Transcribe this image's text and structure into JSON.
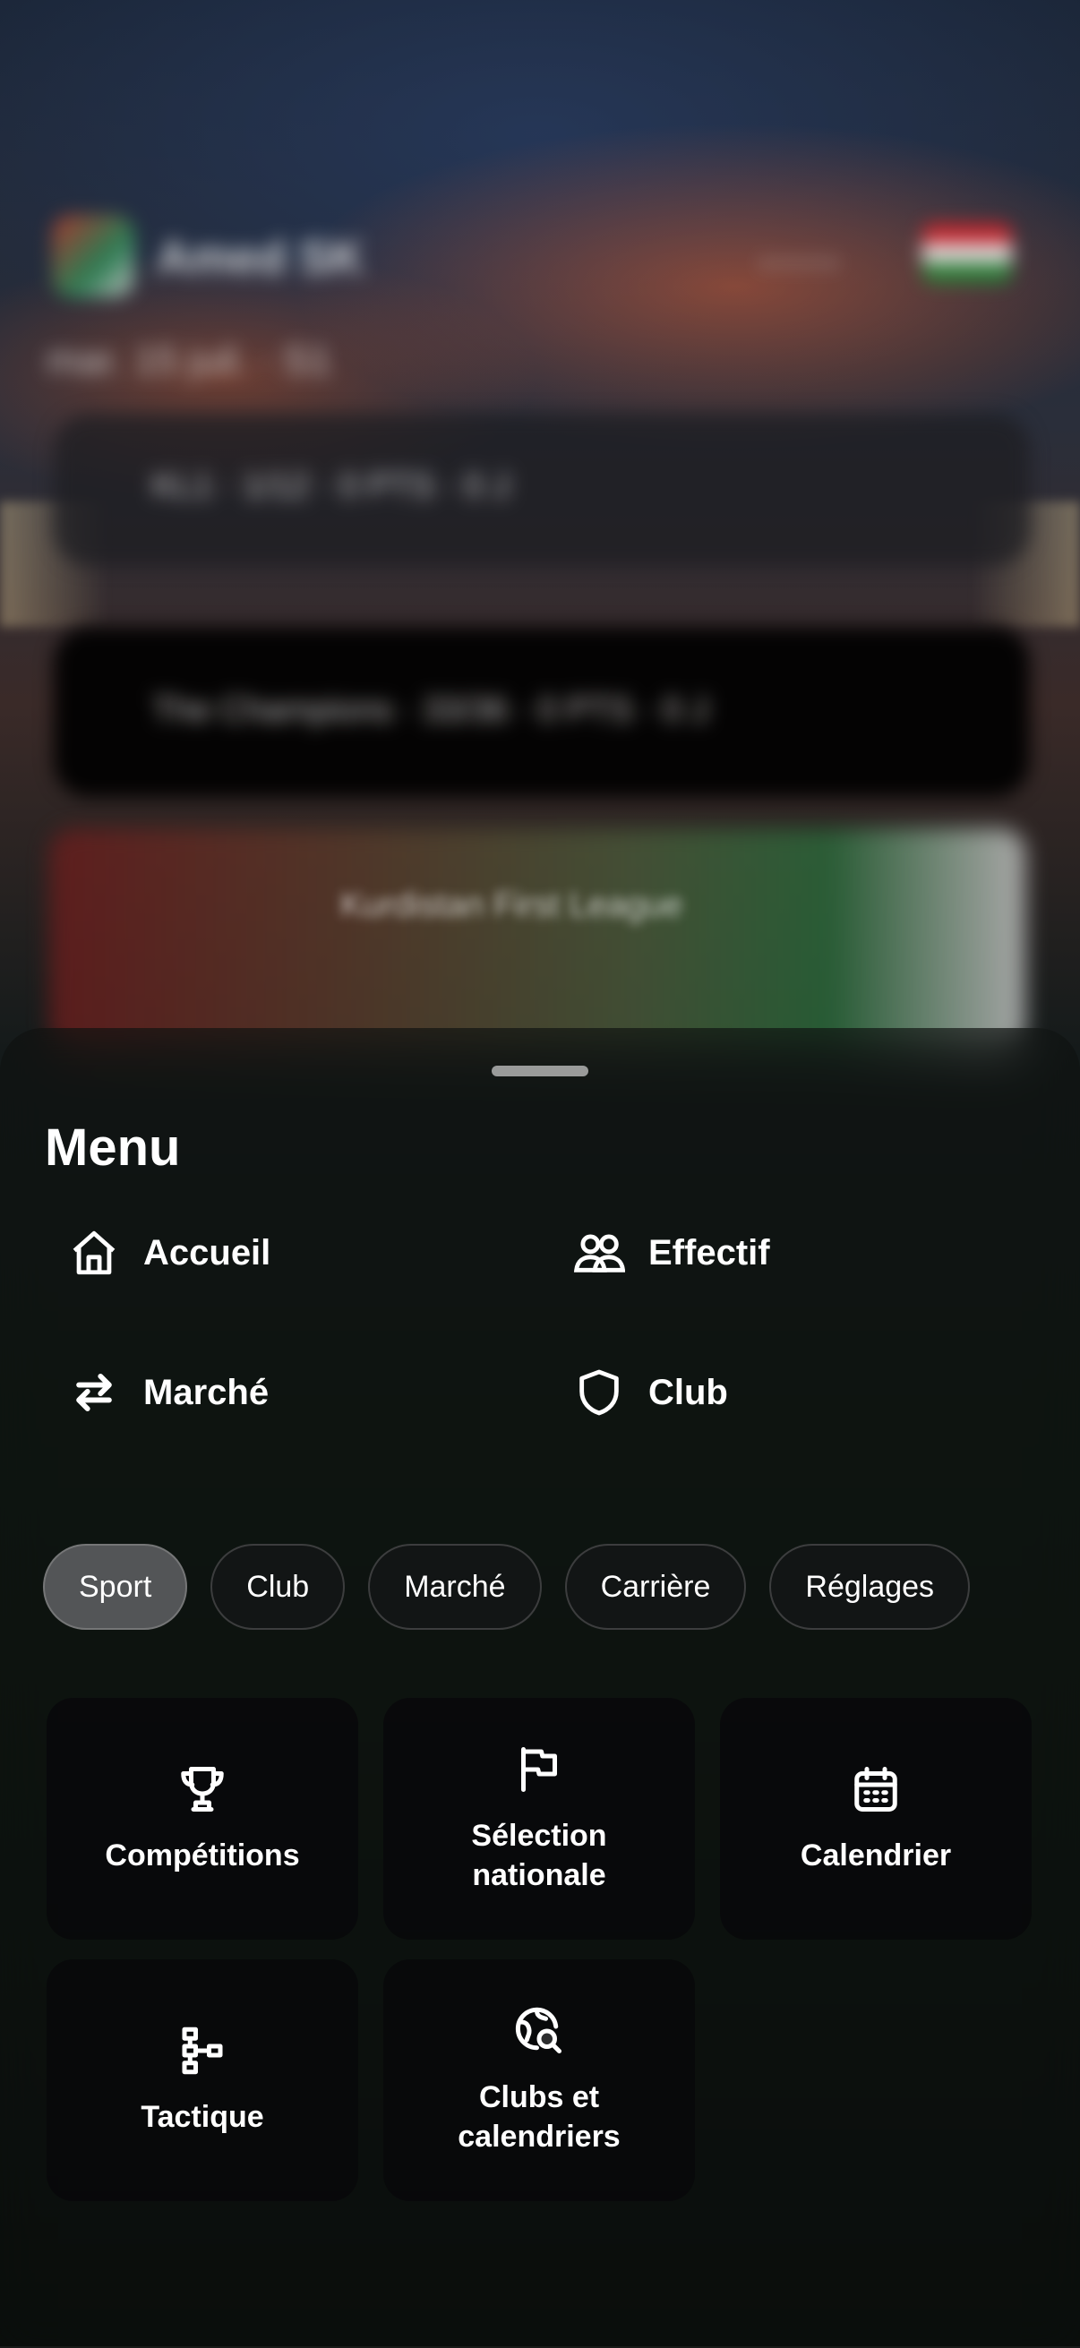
{
  "menu": {
    "title": "Menu",
    "quick_links": [
      {
        "label": "Accueil",
        "icon": "home-icon"
      },
      {
        "label": "Effectif",
        "icon": "users-icon"
      },
      {
        "label": "Marché",
        "icon": "swap-arrows-icon"
      },
      {
        "label": "Club",
        "icon": "shield-icon"
      }
    ],
    "tabs": [
      {
        "label": "Sport",
        "active": true
      },
      {
        "label": "Club",
        "active": false
      },
      {
        "label": "Marché",
        "active": false
      },
      {
        "label": "Carrière",
        "active": false
      },
      {
        "label": "Réglages",
        "active": false
      }
    ],
    "tiles": [
      {
        "label": "Compétitions",
        "icon": "trophy-icon"
      },
      {
        "label": "Sélection nationale",
        "icon": "flag-icon"
      },
      {
        "label": "Calendrier",
        "icon": "calendar-icon"
      },
      {
        "label": "Tactique",
        "icon": "tactics-icon"
      },
      {
        "label": "Clubs et calendriers",
        "icon": "globe-search-icon"
      }
    ]
  },
  "background": {
    "club_name": "Amed SK",
    "date": "mar. 15 juil. · S1",
    "cards": [
      "KL1 · 1/12 · 0 PTS · 0 J",
      "The Champions · 33/36 · 0 PTS · 0 J"
    ],
    "banner": "Kurdistan First League"
  }
}
